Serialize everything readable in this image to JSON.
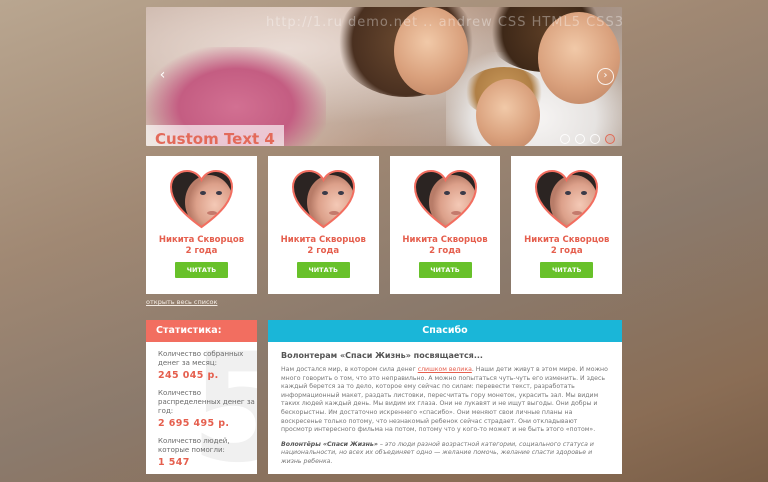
{
  "slider": {
    "watermark": "http://1.ru  demo.net  .. andrew  CSS  HTML5  CSS3  jQuery",
    "caption": "Custom Text 4",
    "prev_arrow": "‹",
    "next_arrow": "›",
    "dots_count": 4,
    "active_dot": 3
  },
  "cards": [
    {
      "name": "Никита Скворцов",
      "age": "2 года",
      "button": "ЧИТАТЬ"
    },
    {
      "name": "Никита Скворцов",
      "age": "2 года",
      "button": "ЧИТАТЬ"
    },
    {
      "name": "Никита Скворцов",
      "age": "2 года",
      "button": "ЧИТАТЬ"
    },
    {
      "name": "Никита Скворцов",
      "age": "2 года",
      "button": "ЧИТАТЬ"
    }
  ],
  "open_list_link": "открыть весь список",
  "stats": {
    "title": "Статистика:",
    "background_digit": "5",
    "items": [
      {
        "label": "Количество собранных денег за месяц:",
        "value": "245 045 р."
      },
      {
        "label": "Количество распределенных денег за год:",
        "value": "2 695 495 р."
      },
      {
        "label": "Количество людей, которые помогли:",
        "value": "1 547"
      }
    ]
  },
  "thanks": {
    "title": "Спасибо",
    "lead": "Волонтерам «Спаси Жизнь» посвящается...",
    "p1_before": "Нам достался мир, в котором сила денег ",
    "p1_link": "слишком велика",
    "p1_after": ". Наши дети живут в этом мире. И можно много говорить о том, что это неправильно. А можно попытаться чуть-чуть его изменить. И здесь каждый берется за то дело, которое ему сейчас по силам: перевести текст, разработать информационный макет, раздать листовки, пересчитать гору монеток, украсить зал. Мы видим таких людей каждый день. Мы видим их глаза. Они не лукавят и не ищут выгоды. Они добры и бескорыстны. Им достаточно искреннего «спасибо». Они меняют свои личные планы на воскресенье только потому, что незнакомый ребенок сейчас страдает. Они откладывают просмотр интересного фильма на потом, потому что у кого-то может и не быть этого «потом».",
    "p2_bold": "Волонтёры «Спаси Жизнь»",
    "p2_text": " – это люди разной возрастной категории, социального статуса и национальности, но всех их объединяет одно — желание помочь, желание спасти здоровье и жизнь ребенка."
  },
  "colors": {
    "accent_red": "#e55f4e",
    "stats_header": "#f26e60",
    "thanks_header": "#1ab6d8",
    "read_button": "#68c12a"
  }
}
